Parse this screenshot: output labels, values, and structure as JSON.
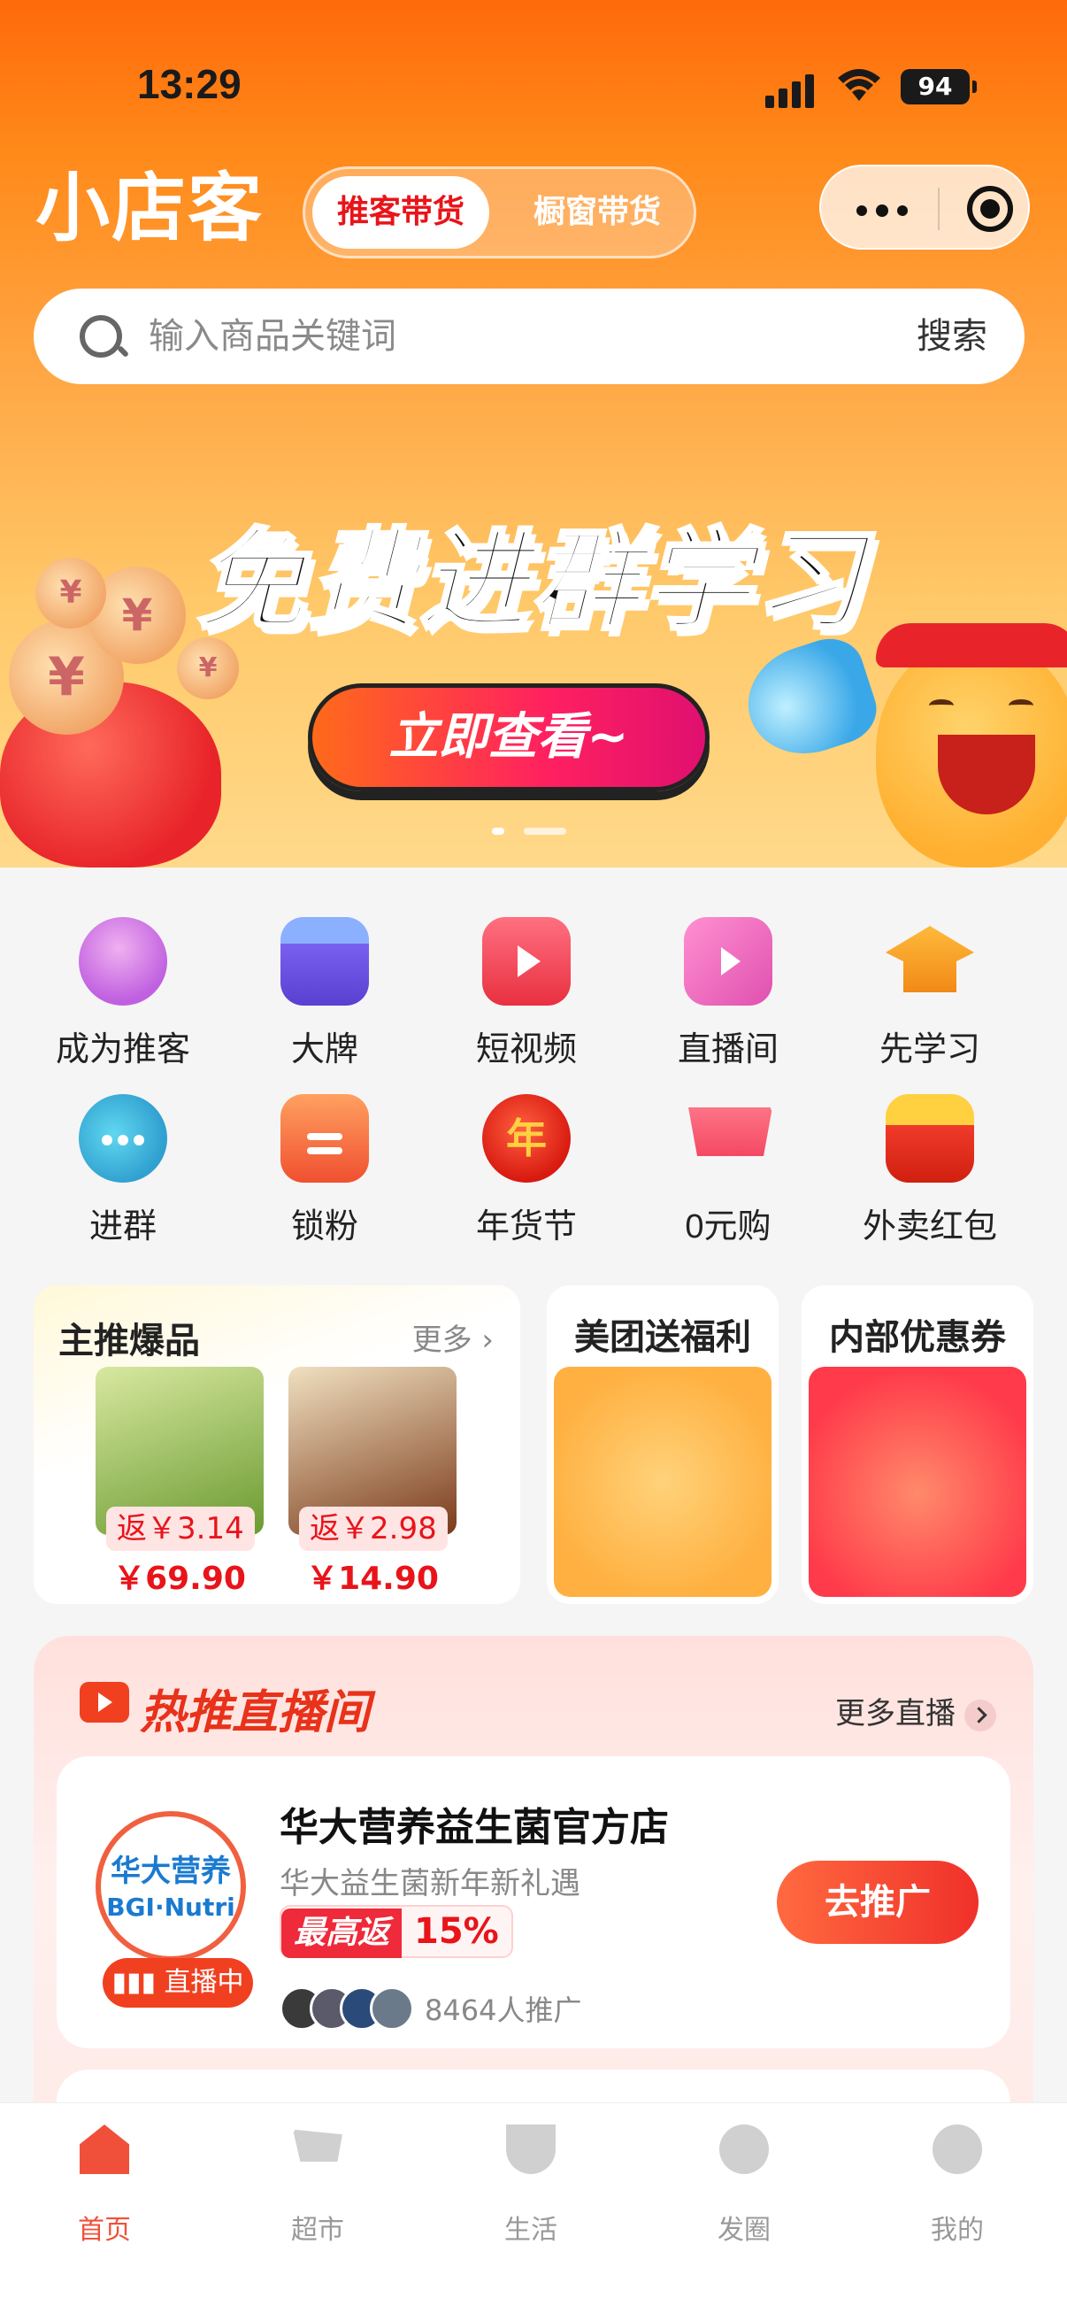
{
  "status_bar": {
    "time": "13:29",
    "battery": "94"
  },
  "header": {
    "logo": "小店客",
    "tab_active": "推客带货",
    "tab_inactive": "橱窗带货"
  },
  "search": {
    "placeholder": "输入商品关键词",
    "button": "搜索"
  },
  "banner": {
    "title": "免费进群学习",
    "cta": "立即查看~"
  },
  "grid": [
    {
      "label": "成为推客",
      "icon": "user-plus-icon",
      "color": "#c060e0"
    },
    {
      "label": "大牌",
      "icon": "store-icon",
      "color": "#7a60f0"
    },
    {
      "label": "短视频",
      "icon": "video-tv-icon",
      "color": "#f04050"
    },
    {
      "label": "直播间",
      "icon": "live-camera-icon",
      "color": "#f060c0"
    },
    {
      "label": "先学习",
      "icon": "graduation-cap-icon",
      "color": "#f0a020"
    },
    {
      "label": "进群",
      "icon": "chat-group-icon",
      "color": "#30b0d0"
    },
    {
      "label": "锁粉",
      "icon": "gift-icon",
      "color": "#f07030"
    },
    {
      "label": "年货节",
      "icon": "lantern-icon",
      "color": "#e8241a"
    },
    {
      "label": "0元购",
      "icon": "shopping-cart-icon",
      "color": "#f04060"
    },
    {
      "label": "外卖红包",
      "icon": "red-packet-icon",
      "color": "#f0302a"
    }
  ],
  "featured": {
    "title": "主推爆品",
    "more": "更多",
    "products": [
      {
        "rebate": "返￥3.14",
        "price": "￥69.90"
      },
      {
        "rebate": "返￥2.98",
        "price": "￥14.90"
      }
    ],
    "meituan_title": "美团送福利",
    "coupon_title": "内部优惠券"
  },
  "live": {
    "title": "热推直播间",
    "more": "更多直播",
    "store": {
      "logo_cn": "华大营养",
      "logo_en": "BGI·Nutri",
      "live_badge": "直播中",
      "name": "华大营养益生菌官方店",
      "subtitle": "华大益生菌新年新礼遇",
      "tag_label": "最高返",
      "tag_value": "15%",
      "promoters": "8464人推广",
      "button": "去推广"
    }
  },
  "tabbar": [
    {
      "label": "首页",
      "icon": "home-icon"
    },
    {
      "label": "超市",
      "icon": "cart-icon"
    },
    {
      "label": "生活",
      "icon": "cup-icon"
    },
    {
      "label": "发圈",
      "icon": "aperture-icon"
    },
    {
      "label": "我的",
      "icon": "user-icon"
    }
  ]
}
